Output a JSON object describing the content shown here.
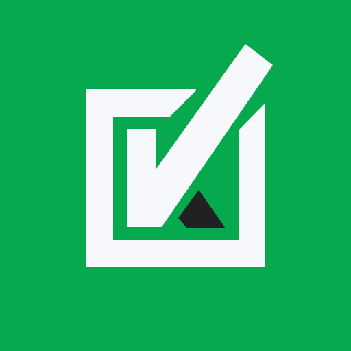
{
  "icon": {
    "name": "checkbox-check-icon",
    "colors": {
      "background": "#06a94e",
      "foreground": "#f7f8fc",
      "accent": "#212121"
    }
  }
}
